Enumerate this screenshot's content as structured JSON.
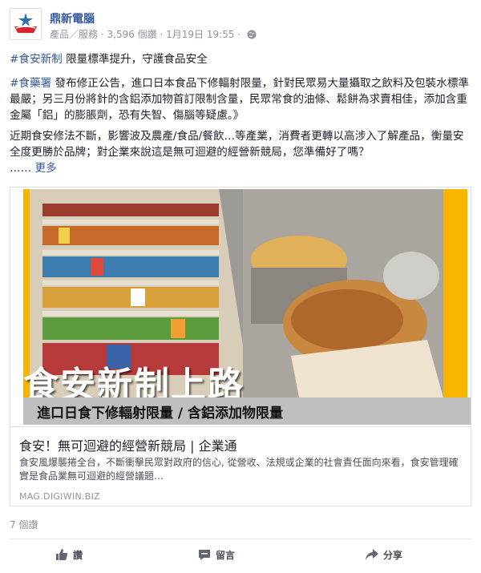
{
  "post": {
    "page_name": "鼎新電腦",
    "category": "產品／服務",
    "views": "3,596 個讚",
    "date": "1月19日 19:55",
    "sep": "·",
    "line1_tag": "#食安新制",
    "line1_text": " 限量標準提升，守護食品安全",
    "line2_tag": "#食藥署",
    "line2_text": " 發布修正公告，進口日本食品下修輻射限量，針對民眾易大量攝取之飲料及包裝水標準最嚴；另三月份將針的含鋁添加物首訂限制含量，民眾常食的油條、鬆餅為求賣相佳，添加含重金屬「鋁」的膨脹劑，恐有失智、傷腦等疑慮。》",
    "line3_text": "近期食安修法不斷，影響波及農產/食品/餐飲…等產業，消費者更轉以高涉入了解產品，衡量安全度更勝於品牌；對企業來說這是無可迴避的經營新競局，您準備好了嗎？",
    "ellipsis": "……",
    "see_more": "更多"
  },
  "card": {
    "headline": "食安新制上路",
    "subheadline": "進口日食下修輻射限量 / 含鋁添加物限量",
    "title": "食安！無可迴避的經營新競局 | 企業通",
    "description": "食安風爆襲捲全台，不斷衝擊民眾對政府的信心, 從營收、法規或企業的社會責任面向來看，食安管理確實是食品業無可迴避的經營議題…",
    "domain": "MAG.DIGIWIN.BIZ"
  },
  "likes_count": "7 個讚",
  "actions": {
    "like": "讚",
    "comment": "留言",
    "share": "分享"
  },
  "colors": {
    "link": "#365899",
    "accent_yellow": "#f7b500"
  }
}
